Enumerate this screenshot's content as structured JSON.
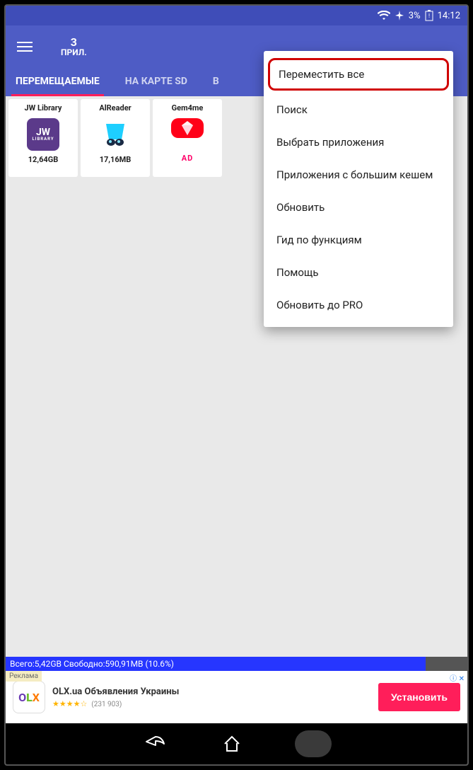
{
  "status": {
    "battery": "3%",
    "time": "14:12"
  },
  "toolbar": {
    "count": "3",
    "count_label": "ПРИЛ."
  },
  "tabs": [
    {
      "label": "ПЕРЕМЕЩАЕМЫЕ",
      "active": true
    },
    {
      "label": "НА КАРТЕ SD",
      "active": false
    },
    {
      "label": "В",
      "active": false
    }
  ],
  "apps": [
    {
      "name": "JW Library",
      "meta": "12,64GB",
      "icon": "jw"
    },
    {
      "name": "AlReader",
      "meta": "17,16MB",
      "icon": "alr"
    },
    {
      "name": "Gem4me",
      "meta": "AD",
      "icon": "gem",
      "ad": true
    }
  ],
  "menu": [
    "Переместить все",
    "Поиск",
    "Выбрать приложения",
    "Приложения с большим кешем",
    "Обновить",
    "Гид по функциям",
    "Помощь",
    "Обновить до PRO"
  ],
  "storage": {
    "text": "Всего:5,42GB Свободно:590,91MB (10.6%)"
  },
  "ad": {
    "label": "Реклама",
    "title": "OLX.ua Объявления Украины",
    "stars": "★★★★☆",
    "count": "(231 903)",
    "button": "Установить",
    "choices_icon": "ⓘ ✕"
  }
}
